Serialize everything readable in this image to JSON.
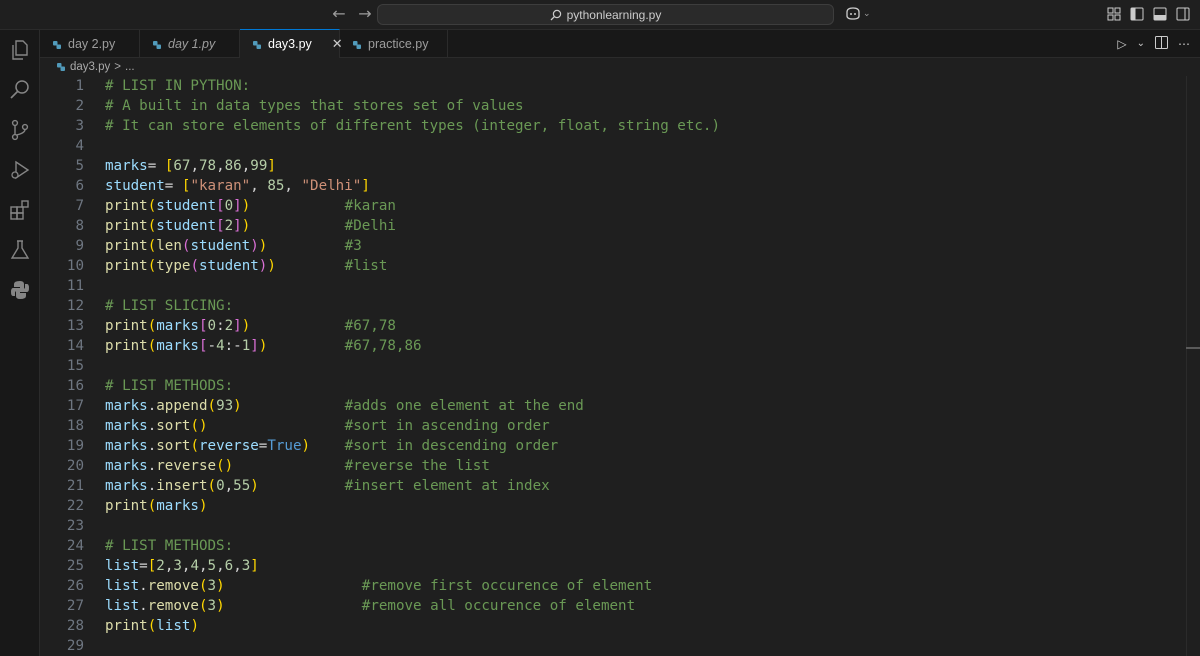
{
  "titlebar": {
    "search_text": "pythonlearning.py",
    "back_icon": "arrow-left-icon",
    "forward_icon": "arrow-right-icon"
  },
  "tabs": [
    {
      "label": "day 2.py",
      "italic": false,
      "active": false
    },
    {
      "label": "day 1.py",
      "italic": true,
      "active": false
    },
    {
      "label": "day3.py",
      "italic": false,
      "active": true
    },
    {
      "label": "practice.py",
      "italic": false,
      "active": false
    }
  ],
  "breadcrumb": {
    "file": "day3.py",
    "separator": ">",
    "rest": "..."
  },
  "code_lines": [
    {
      "n": "1",
      "tokens": [
        [
          "c-comment",
          "# LIST IN PYTHON:"
        ]
      ],
      "comment": ""
    },
    {
      "n": "2",
      "tokens": [
        [
          "c-comment",
          "# A built in data types that stores set of values"
        ]
      ],
      "comment": ""
    },
    {
      "n": "3",
      "tokens": [
        [
          "c-comment",
          "# It can store elements of different types (integer, float, string etc.)"
        ]
      ],
      "comment": ""
    },
    {
      "n": "4",
      "tokens": [],
      "comment": ""
    },
    {
      "n": "5",
      "tokens": [
        [
          "c-var",
          "marks"
        ],
        [
          "c-op",
          "= "
        ],
        [
          "c-b1",
          "["
        ],
        [
          "c-num",
          "67"
        ],
        [
          "c-op",
          ","
        ],
        [
          "c-num",
          "78"
        ],
        [
          "c-op",
          ","
        ],
        [
          "c-num",
          "86"
        ],
        [
          "c-op",
          ","
        ],
        [
          "c-num",
          "99"
        ],
        [
          "c-b1",
          "]"
        ]
      ],
      "comment": ""
    },
    {
      "n": "6",
      "tokens": [
        [
          "c-var",
          "student"
        ],
        [
          "c-op",
          "= "
        ],
        [
          "c-b1",
          "["
        ],
        [
          "c-str",
          "\"karan\""
        ],
        [
          "c-op",
          ", "
        ],
        [
          "c-num",
          "85"
        ],
        [
          "c-op",
          ", "
        ],
        [
          "c-str",
          "\"Delhi\""
        ],
        [
          "c-b1",
          "]"
        ]
      ],
      "comment": ""
    },
    {
      "n": "7",
      "tokens": [
        [
          "c-fn",
          "print"
        ],
        [
          "c-b1",
          "("
        ],
        [
          "c-var",
          "student"
        ],
        [
          "c-b2",
          "["
        ],
        [
          "c-num",
          "0"
        ],
        [
          "c-b2",
          "]"
        ],
        [
          "c-b1",
          ")"
        ]
      ],
      "comment": "#karan",
      "comment_col": 28
    },
    {
      "n": "8",
      "tokens": [
        [
          "c-fn",
          "print"
        ],
        [
          "c-b1",
          "("
        ],
        [
          "c-var",
          "student"
        ],
        [
          "c-b2",
          "["
        ],
        [
          "c-num",
          "2"
        ],
        [
          "c-b2",
          "]"
        ],
        [
          "c-b1",
          ")"
        ]
      ],
      "comment": "#Delhi",
      "comment_col": 28
    },
    {
      "n": "9",
      "tokens": [
        [
          "c-fn",
          "print"
        ],
        [
          "c-b1",
          "("
        ],
        [
          "c-fn",
          "len"
        ],
        [
          "c-b2",
          "("
        ],
        [
          "c-var",
          "student"
        ],
        [
          "c-b2",
          ")"
        ],
        [
          "c-b1",
          ")"
        ]
      ],
      "comment": "#3",
      "comment_col": 28
    },
    {
      "n": "10",
      "tokens": [
        [
          "c-fn",
          "print"
        ],
        [
          "c-b1",
          "("
        ],
        [
          "c-fn",
          "type"
        ],
        [
          "c-b2",
          "("
        ],
        [
          "c-var",
          "student"
        ],
        [
          "c-b2",
          ")"
        ],
        [
          "c-b1",
          ")"
        ]
      ],
      "comment": "#list",
      "comment_col": 28
    },
    {
      "n": "11",
      "tokens": [],
      "comment": ""
    },
    {
      "n": "12",
      "tokens": [
        [
          "c-comment",
          "# LIST SLICING:"
        ]
      ],
      "comment": ""
    },
    {
      "n": "13",
      "tokens": [
        [
          "c-fn",
          "print"
        ],
        [
          "c-b1",
          "("
        ],
        [
          "c-var",
          "marks"
        ],
        [
          "c-b2",
          "["
        ],
        [
          "c-num",
          "0"
        ],
        [
          "c-op",
          ":"
        ],
        [
          "c-num",
          "2"
        ],
        [
          "c-b2",
          "]"
        ],
        [
          "c-b1",
          ")"
        ]
      ],
      "comment": "#67,78",
      "comment_col": 28
    },
    {
      "n": "14",
      "tokens": [
        [
          "c-fn",
          "print"
        ],
        [
          "c-b1",
          "("
        ],
        [
          "c-var",
          "marks"
        ],
        [
          "c-b2",
          "["
        ],
        [
          "c-op",
          "-"
        ],
        [
          "c-num",
          "4"
        ],
        [
          "c-op",
          ":-"
        ],
        [
          "c-num",
          "1"
        ],
        [
          "c-b2",
          "]"
        ],
        [
          "c-b1",
          ")"
        ]
      ],
      "comment": "#67,78,86",
      "comment_col": 28
    },
    {
      "n": "15",
      "tokens": [],
      "comment": ""
    },
    {
      "n": "16",
      "tokens": [
        [
          "c-comment",
          "# LIST METHODS:"
        ]
      ],
      "comment": ""
    },
    {
      "n": "17",
      "tokens": [
        [
          "c-var",
          "marks"
        ],
        [
          "c-op",
          "."
        ],
        [
          "c-fn",
          "append"
        ],
        [
          "c-b1",
          "("
        ],
        [
          "c-num",
          "93"
        ],
        [
          "c-b1",
          ")"
        ]
      ],
      "comment": "#adds one element at the end",
      "comment_col": 28
    },
    {
      "n": "18",
      "tokens": [
        [
          "c-var",
          "marks"
        ],
        [
          "c-op",
          "."
        ],
        [
          "c-fn",
          "sort"
        ],
        [
          "c-b1",
          "()"
        ]
      ],
      "comment": "#sort in ascending order",
      "comment_col": 28
    },
    {
      "n": "19",
      "tokens": [
        [
          "c-var",
          "marks"
        ],
        [
          "c-op",
          "."
        ],
        [
          "c-fn",
          "sort"
        ],
        [
          "c-b1",
          "("
        ],
        [
          "c-param",
          "reverse"
        ],
        [
          "c-op",
          "="
        ],
        [
          "c-kw",
          "True"
        ],
        [
          "c-b1",
          ")"
        ]
      ],
      "comment": "#sort in descending order",
      "comment_col": 28
    },
    {
      "n": "20",
      "tokens": [
        [
          "c-var",
          "marks"
        ],
        [
          "c-op",
          "."
        ],
        [
          "c-fn",
          "reverse"
        ],
        [
          "c-b1",
          "()"
        ]
      ],
      "comment": "#reverse the list",
      "comment_col": 28
    },
    {
      "n": "21",
      "tokens": [
        [
          "c-var",
          "marks"
        ],
        [
          "c-op",
          "."
        ],
        [
          "c-fn",
          "insert"
        ],
        [
          "c-b1",
          "("
        ],
        [
          "c-num",
          "0"
        ],
        [
          "c-op",
          ","
        ],
        [
          "c-num",
          "55"
        ],
        [
          "c-b1",
          ")"
        ]
      ],
      "comment": "#insert element at index",
      "comment_col": 28
    },
    {
      "n": "22",
      "tokens": [
        [
          "c-fn",
          "print"
        ],
        [
          "c-b1",
          "("
        ],
        [
          "c-var",
          "marks"
        ],
        [
          "c-b1",
          ")"
        ]
      ],
      "comment": ""
    },
    {
      "n": "23",
      "tokens": [],
      "comment": ""
    },
    {
      "n": "24",
      "tokens": [
        [
          "c-comment",
          "# LIST METHODS:"
        ]
      ],
      "comment": ""
    },
    {
      "n": "25",
      "tokens": [
        [
          "c-var",
          "list"
        ],
        [
          "c-op",
          "="
        ],
        [
          "c-b1",
          "["
        ],
        [
          "c-num",
          "2"
        ],
        [
          "c-op",
          ","
        ],
        [
          "c-num",
          "3"
        ],
        [
          "c-op",
          ","
        ],
        [
          "c-num",
          "4"
        ],
        [
          "c-op",
          ","
        ],
        [
          "c-num",
          "5"
        ],
        [
          "c-op",
          ","
        ],
        [
          "c-num",
          "6"
        ],
        [
          "c-op",
          ","
        ],
        [
          "c-num",
          "3"
        ],
        [
          "c-b1",
          "]"
        ]
      ],
      "comment": ""
    },
    {
      "n": "26",
      "tokens": [
        [
          "c-var",
          "list"
        ],
        [
          "c-op",
          "."
        ],
        [
          "c-fn",
          "remove"
        ],
        [
          "c-b1",
          "("
        ],
        [
          "c-num",
          "3"
        ],
        [
          "c-b1",
          ")"
        ]
      ],
      "comment": "#remove first occurence of element",
      "comment_col": 30
    },
    {
      "n": "27",
      "tokens": [
        [
          "c-var",
          "list"
        ],
        [
          "c-op",
          "."
        ],
        [
          "c-fn",
          "remove"
        ],
        [
          "c-b1",
          "("
        ],
        [
          "c-num",
          "3"
        ],
        [
          "c-b1",
          ")"
        ]
      ],
      "comment": "#remove all occurence of element",
      "comment_col": 30
    },
    {
      "n": "28",
      "tokens": [
        [
          "c-fn",
          "print"
        ],
        [
          "c-b1",
          "("
        ],
        [
          "c-var",
          "list"
        ],
        [
          "c-b1",
          ")"
        ]
      ],
      "comment": ""
    },
    {
      "n": "29",
      "tokens": [],
      "comment": ""
    }
  ],
  "colors": {
    "editor_bg": "#1f1f1f",
    "accent": "#0078d4",
    "comment": "#6a9955",
    "python_icon": "#519aba"
  },
  "activity_icons": [
    "files-icon",
    "search-icon",
    "source-control-icon",
    "run-debug-icon",
    "extensions-icon",
    "testing-icon",
    "python-icon"
  ]
}
